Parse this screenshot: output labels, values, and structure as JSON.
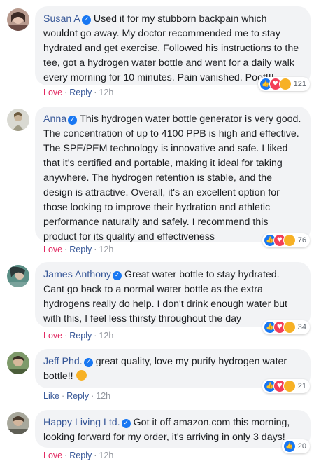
{
  "comments": [
    {
      "author": "Susan A",
      "text": "Used it for my stubborn backpain which wouldnt go away. My doctor recommended me to stay hydrated and get exercise. Followed his instructions to the tee, got a hydrogen water bottle and went for a daily walk every morning for 10 minutes. Pain vanished. Poof!!!",
      "action_primary": "Love",
      "action_reply": "Reply",
      "time": "12h",
      "reaction_count": "121"
    },
    {
      "author": "Anna",
      "text": "This hydrogen water bottle generator is very good. The concentration of up to 4100 PPB is high and effective. The SPE/PEM technology is innovative and safe. I liked that it's certified and portable, making it ideal for taking anywhere. The hydrogen retention is stable, and the design is attractive. Overall, it's an excellent option for those looking to improve their hydration and athletic performance naturally and safely. I recommend this product for its quality and effectiveness",
      "action_primary": "Love",
      "action_reply": "Reply",
      "time": "12h",
      "reaction_count": "76"
    },
    {
      "author": "James Anthony",
      "text": "Great water bottle to stay hydrated. Cant go back to a normal water bottle as the extra hydrogens really do help. I don't drink enough water but with this, I feel less thirsty throughout the day",
      "action_primary": "Love",
      "action_reply": "Reply",
      "time": "12h",
      "reaction_count": "34"
    },
    {
      "author": "Jeff Phd.",
      "text": "great quality, love my purify hydrogen water bottle!!",
      "action_primary": "Like",
      "action_reply": "Reply",
      "time": "12h",
      "reaction_count": "21"
    },
    {
      "author": "Happy Living Ltd.",
      "text": "Got it off amazon.com this morning, looking forward for my order, it's arriving in only 3 days!",
      "action_primary": "Love",
      "action_reply": "Reply",
      "time": "12h",
      "reaction_count": "20"
    }
  ],
  "separator": "·",
  "colors": {
    "author": "#385898",
    "love": "#e0245e",
    "bubble": "#f2f3f5",
    "like_blue": "#1877f2",
    "heart_red": "#f33e58",
    "emoji_yellow": "#f7b125"
  }
}
